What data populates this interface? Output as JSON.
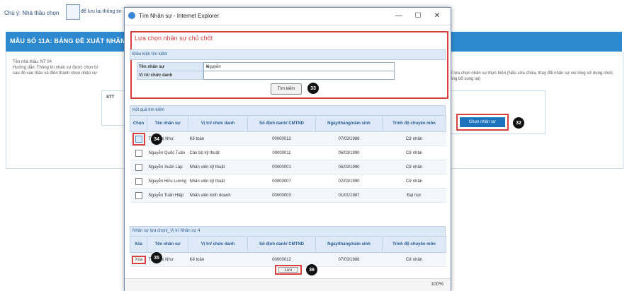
{
  "background": {
    "note": "Chú ý: Nhà thầu chọn",
    "file_text": "để lưu lại thông tin",
    "banner_title": "MẪU SỐ 11A: BẢNG ĐỀ XUẤT NHÂN",
    "info_line1": "Tên nhà thầu: NT 04",
    "info_line2": "Hướng dẫn: Thông tin nhân sự được chọn từ",
    "info_line3": "sau đó vào thầu và điền thành chọn nhân sự",
    "right_text": "để lựa chọn nhân sự thực hiện (Nếu sửa chữa, thay đổi nhân sự vui lòng sử dụng chức năng bổ sung lại)",
    "small_box_label": "STT",
    "select_staff_button": "Chọn nhân sự",
    "badge_32": "32"
  },
  "dialog": {
    "title": "Tìm Nhân sự - Internet Explorer",
    "controls": {
      "minimize": "—",
      "maximize": "☐",
      "close": "✕"
    },
    "header": "Lựa chọn nhân sự chủ chốt",
    "search_section": "Điều kiện tìm kiếm",
    "fields": {
      "name_label": "Tên nhân sự",
      "name_value": "Nguyễn",
      "position_label": "Vị trí/ chức danh",
      "position_value": ""
    },
    "search_button": "Tìm kiếm",
    "badge_33": "33",
    "results_section": "Kết quả tìm kiếm",
    "results_headers": [
      "Chọn",
      "Tên nhân sự",
      "Vị trí/ chức danh",
      "Số định danh/ CMTND",
      "Ngày/tháng/năm sinh",
      "Trình độ chuyên môn"
    ],
    "results_rows": [
      {
        "checked": true,
        "name": "Trần Thị Như",
        "position": "Kế toán",
        "id": "00000012",
        "dob": "07/03/1988",
        "level": "Cử nhân"
      },
      {
        "checked": false,
        "name": "Nguyễn Quốc Tuấn",
        "position": "Cán bộ kỹ thuật",
        "id": "00000011",
        "dob": "06/03/1990",
        "level": "Cử nhân"
      },
      {
        "checked": false,
        "name": "Nguyễn Xuân Lập",
        "position": "Nhân viên kỹ thuật",
        "id": "00000001",
        "dob": "05/03/1990",
        "level": "Cử nhân"
      },
      {
        "checked": false,
        "name": "Nguyễn Hữu Lương",
        "position": "Nhân viên kỹ thuật",
        "id": "00000007",
        "dob": "02/03/1990",
        "level": "Cử nhân"
      },
      {
        "checked": false,
        "name": "Nguyễn Tuấn Hiệp",
        "position": "Nhân viên kinh doanh",
        "id": "00000003",
        "dob": "01/01/1987",
        "level": "Đại học"
      }
    ],
    "badge_34": "34",
    "selected_section": "Nhân sự lựa chọn(_Vị trí Nhân sự 4",
    "selected_headers": [
      "Xóa",
      "Tên nhân sự",
      "Vị trí/ chức danh",
      "Số định danh/ CMTND",
      "Ngày/tháng/năm sinh",
      "Trình độ chuyên môn"
    ],
    "selected_rows": [
      {
        "delete": "Xóa",
        "name": "Trần Thị Như",
        "position": "Kế toán",
        "id": "00000012",
        "dob": "07/03/1988",
        "level": "Cử nhân"
      }
    ],
    "badge_35": "35",
    "close_button": "Lưu",
    "badge_36": "36",
    "zoom": "100%"
  }
}
